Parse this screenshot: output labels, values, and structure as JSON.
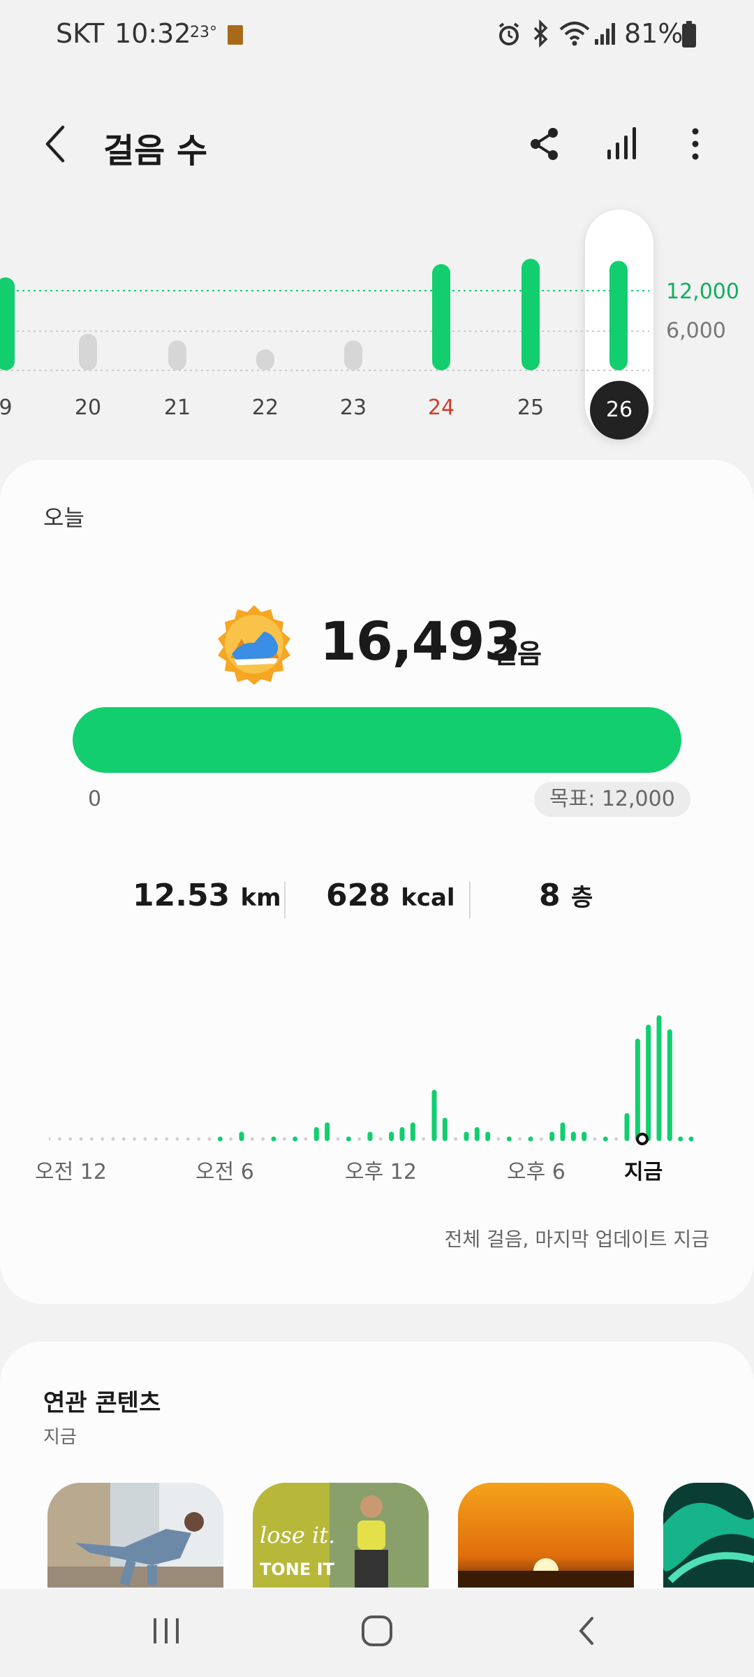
{
  "status_bar": {
    "carrier": "SKT",
    "time": "10:32",
    "temperature": "23°",
    "battery": "81%",
    "icons": [
      "alarm-icon",
      "bluetooth-icon",
      "wifi-icon",
      "signal-icon",
      "battery-icon"
    ]
  },
  "header": {
    "title": "걸음 수",
    "icons": [
      "back-icon",
      "share-icon",
      "trends-icon",
      "more-icon"
    ]
  },
  "weekly": {
    "days": [
      "9",
      "20",
      "21",
      "22",
      "23",
      "24",
      "25",
      "26"
    ],
    "highlighted_day": "24",
    "selected_day": "26",
    "steps": [
      14000,
      5500,
      4500,
      3000,
      4500,
      16000,
      16800,
      16493
    ],
    "goal_label": "12,000",
    "mid_label": "6,000",
    "colors": {
      "met": "#12ce6e",
      "missed": "#d6d6d6",
      "goal_line": "#12ce6e",
      "highlight_red": "#d23b2a"
    }
  },
  "today": {
    "label": "오늘",
    "steps": "16,493",
    "steps_unit": "걸음",
    "progress_fraction": 1.0,
    "progress_start": "0",
    "goal": "목표: 12,000",
    "distance_value": "12.53",
    "distance_unit": "km",
    "calories_value": "628",
    "calories_unit": "kcal",
    "floors_value": "8",
    "floors_unit": "층",
    "accent": "#12ce6e"
  },
  "hourly": {
    "labels": [
      "오전 12",
      "오전 6",
      "오후 12",
      "오후 6"
    ],
    "now_label": "지금",
    "updated": "전체 걸음, 마지막 업데이트 지금",
    "values": [
      0,
      0,
      0,
      0,
      0,
      0,
      0,
      0,
      0,
      0,
      0,
      0,
      0,
      0,
      0,
      0,
      1,
      0,
      2,
      0,
      0,
      1,
      0,
      1,
      0,
      3,
      4,
      0,
      1,
      0,
      2,
      0,
      2,
      3,
      4,
      0,
      11,
      5,
      0,
      2,
      3,
      2,
      0,
      1,
      0,
      1,
      0,
      2,
      4,
      2,
      2,
      0,
      1,
      0,
      6,
      22,
      25,
      27,
      24,
      1,
      1
    ]
  },
  "related": {
    "title": "연관 콘텐츠",
    "time": "지금",
    "thumb_text": "lose it.",
    "thumb_text2": "TONE IT"
  },
  "navbar": {
    "icons": [
      "recent-apps-icon",
      "home-icon",
      "back-nav-icon"
    ]
  }
}
